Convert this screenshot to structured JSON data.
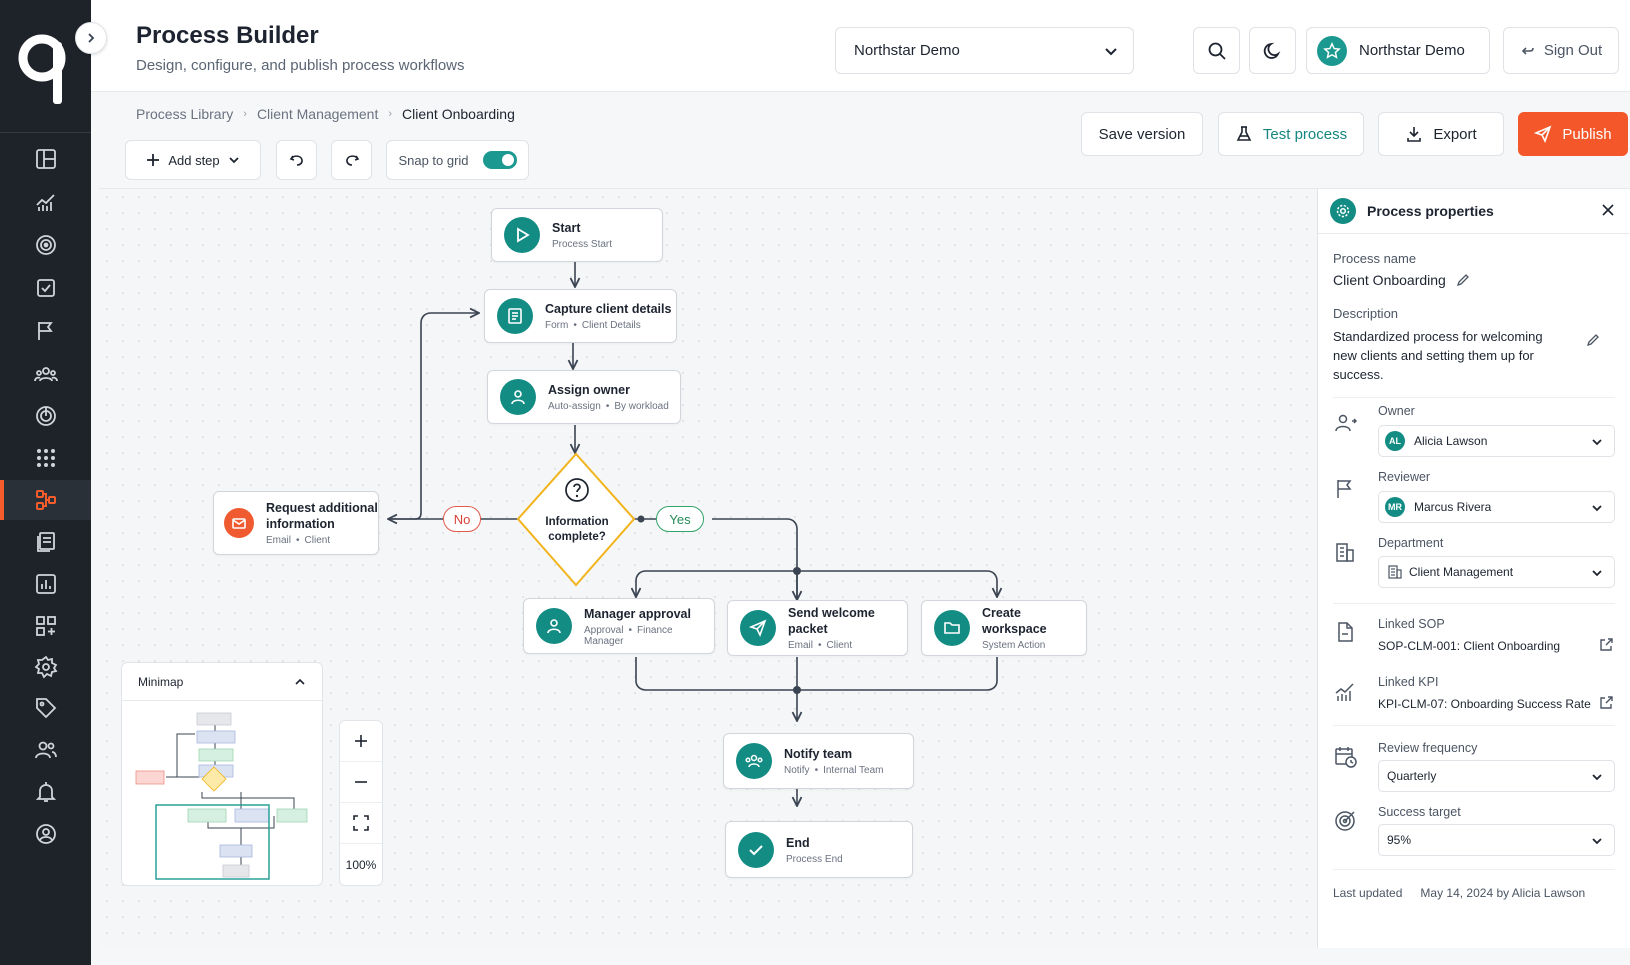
{
  "header": {
    "title": "Process Builder",
    "subtitle": "Design, configure, and publish process workflows",
    "workspace": "Northstar Demo",
    "account_name": "Northstar Demo",
    "sign_out": "Sign Out"
  },
  "breadcrumb": [
    "Process Library",
    "Client Management",
    "Client Onboarding"
  ],
  "actions": {
    "save_version": "Save version",
    "test_process": "Test process",
    "export": "Export",
    "publish": "Publish"
  },
  "toolbar": {
    "add_step": "Add step",
    "snap_to_grid": "Snap to grid",
    "snap_enabled": true
  },
  "flow": {
    "start": {
      "title": "Start",
      "sub": "Process Start"
    },
    "capture": {
      "title": "Capture client details",
      "sub1": "Form",
      "sub2": "Client Details"
    },
    "assign": {
      "title": "Assign owner",
      "sub1": "Auto-assign",
      "sub2": "By workload"
    },
    "decision": {
      "line1": "Information",
      "line2": "complete?"
    },
    "request": {
      "title1": "Request additional",
      "title2": "information",
      "sub1": "Email",
      "sub2": "Client"
    },
    "no_label": "No",
    "yes_label": "Yes",
    "manager": {
      "title": "Manager approval",
      "sub1": "Approval",
      "sub2": "Finance Manager"
    },
    "welcome": {
      "title": "Send welcome packet",
      "sub1": "Email",
      "sub2": "Client"
    },
    "workspace": {
      "title": "Create workspace",
      "sub1": "System Action"
    },
    "notify": {
      "title": "Notify team",
      "sub1": "Notify",
      "sub2": "Internal Team"
    },
    "end": {
      "title": "End",
      "sub": "Process End"
    }
  },
  "minimap": {
    "title": "Minimap"
  },
  "zoom": {
    "level": "100%"
  },
  "properties": {
    "title": "Process properties",
    "process_name_label": "Process name",
    "process_name": "Client Onboarding",
    "description_label": "Description",
    "description": "Standardized process for welcoming new clients and setting them up for success.",
    "owner_label": "Owner",
    "owner_initials": "AL",
    "owner": "Alicia Lawson",
    "reviewer_label": "Reviewer",
    "reviewer_initials": "MR",
    "reviewer": "Marcus Rivera",
    "department_label": "Department",
    "department": "Client Management",
    "linked_sop_label": "Linked SOP",
    "linked_sop": "SOP-CLM-001: Client Onboarding",
    "linked_kpi_label": "Linked KPI",
    "linked_kpi": "KPI-CLM-07: Onboarding Success Rate",
    "review_frequency_label": "Review frequency",
    "review_frequency": "Quarterly",
    "success_target_label": "Success target",
    "success_target": "95%",
    "last_updated_label": "Last updated",
    "last_updated": "May 14, 2024 by Alicia Lawson"
  },
  "colors": {
    "accent": "#138c84",
    "publish": "#f4582a",
    "sidebar": "#1e2329",
    "decision": "#f2b31b"
  },
  "sidebar_icons": [
    "layout-icon",
    "analytics-icon",
    "target-icon",
    "tasks-icon",
    "flag-icon",
    "team-icon",
    "radar-icon",
    "apps-grid-icon",
    "process-flow-icon",
    "documents-icon",
    "reports-icon",
    "add-widget-icon",
    "settings-icon",
    "tag-icon",
    "users-icon",
    "bell-icon",
    "profile-icon"
  ]
}
